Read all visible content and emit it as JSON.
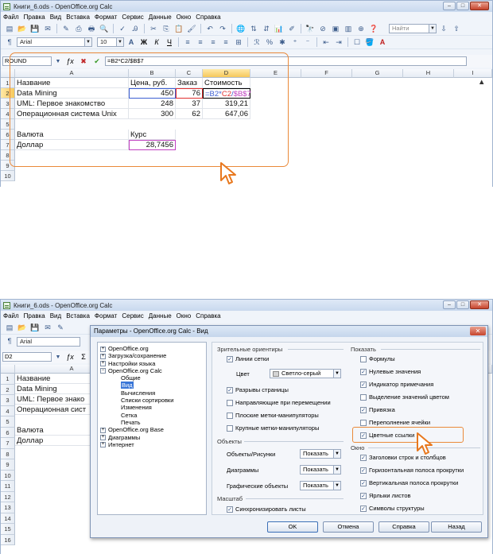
{
  "window_title": "Книги_6.ods - OpenOffice.org Calc",
  "menu": [
    "Файл",
    "Правка",
    "Вид",
    "Вставка",
    "Формат",
    "Сервис",
    "Данные",
    "Окно",
    "Справка"
  ],
  "font_name": "Arial",
  "font_size": "10",
  "search_placeholder": "Найти",
  "cell_ref": "ROUND",
  "formula": "=B2*C2/$B$7",
  "cell_ref2": "D2",
  "formula_icons": {
    "fx": "ƒx",
    "cancel": "✖",
    "accept": "✔",
    "sum": "Σ"
  },
  "columns": [
    "A",
    "B",
    "C",
    "D",
    "E",
    "F",
    "G",
    "H",
    "I"
  ],
  "rows": [
    "1",
    "2",
    "3",
    "4",
    "5",
    "6",
    "7",
    "8",
    "9",
    "10"
  ],
  "rows2": [
    "1",
    "2",
    "3",
    "4",
    "5",
    "6",
    "7",
    "8",
    "9",
    "10",
    "11",
    "12",
    "13",
    "14",
    "15",
    "16"
  ],
  "sheet": {
    "r1": {
      "a": "Название",
      "b": "Цена, руб.",
      "c": "Заказ",
      "d": "Стоимость"
    },
    "r2": {
      "a": "Data Mining",
      "b": "450",
      "c": "76"
    },
    "formula_parts": {
      "p1": "=B2*",
      "p2": "C2",
      "p3": "/",
      "p4": "$B$7"
    },
    "r3": {
      "a": "UML: Первое знакомство",
      "b": "248",
      "c": "37",
      "d": "319,21"
    },
    "r4": {
      "a": "Операционная система Unix",
      "b": "300",
      "c": "62",
      "d": "647,06"
    },
    "r6": {
      "a": "Валюта",
      "b": "Курс"
    },
    "r7": {
      "a": "Доллар",
      "b": "28,7456"
    }
  },
  "sheet2": {
    "r1": "Название",
    "r2": "Data Mining",
    "r3": "UML: Первое знако",
    "r4": "Операционная сист",
    "r6": "Валюта",
    "r7": "Доллар"
  },
  "dialog": {
    "title": "Параметры - OpenOffice.org Calc - Вид",
    "tree": [
      {
        "label": "OpenOffice.org",
        "level": 0
      },
      {
        "label": "Загрузка/сохранение",
        "level": 0
      },
      {
        "label": "Настройки языка",
        "level": 0
      },
      {
        "label": "OpenOffice.org Calc",
        "level": 0,
        "open": true
      },
      {
        "label": "Общие",
        "level": 1
      },
      {
        "label": "Вид",
        "level": 1,
        "selected": true
      },
      {
        "label": "Вычисления",
        "level": 1
      },
      {
        "label": "Списки сортировки",
        "level": 1
      },
      {
        "label": "Изменения",
        "level": 1
      },
      {
        "label": "Сетка",
        "level": 1
      },
      {
        "label": "Печать",
        "level": 1
      },
      {
        "label": "OpenOffice.org Base",
        "level": 0
      },
      {
        "label": "Диаграммы",
        "level": 0
      },
      {
        "label": "Интернет",
        "level": 0
      }
    ],
    "visual_aids": {
      "title": "Зрительные ориентиры",
      "grid_lines": "Линии сетки",
      "color_label": "Цвет",
      "color_value": "Светло-серый",
      "page_breaks": "Разрывы страницы",
      "guides": "Направляющие при перемещении",
      "simple_handles": "Плоские метки-манипуляторы",
      "large_handles": "Крупные метки-манипуляторы"
    },
    "objects": {
      "title": "Объекты",
      "objects_images": "Объекты/Рисунки",
      "charts": "Диаграммы",
      "drawing": "Графические объекты",
      "show": "Показать"
    },
    "zoom": {
      "title": "Масштаб",
      "sync": "Синхронизировать листы"
    },
    "display": {
      "title": "Показать",
      "formulas": "Формулы",
      "zero": "Нулевые значения",
      "comment": "Индикатор примечания",
      "highlight": "Выделение значений цветом",
      "anchor": "Привязка",
      "overflow": "Переполнение ячейки",
      "refs": "Цветные ссылки"
    },
    "window": {
      "title": "Окно",
      "headers": "Заголовки строк и столбцов",
      "hscroll": "Горизонтальная полоса прокрутки",
      "vscroll": "Вертикальная полоса прокрутки",
      "tabs": "Ярлыки листов",
      "outline": "Символы структуры"
    },
    "buttons": {
      "ok": "OK",
      "cancel": "Отмена",
      "help": "Справка",
      "back": "Назад"
    }
  },
  "accent_color": "#ea8a3a"
}
